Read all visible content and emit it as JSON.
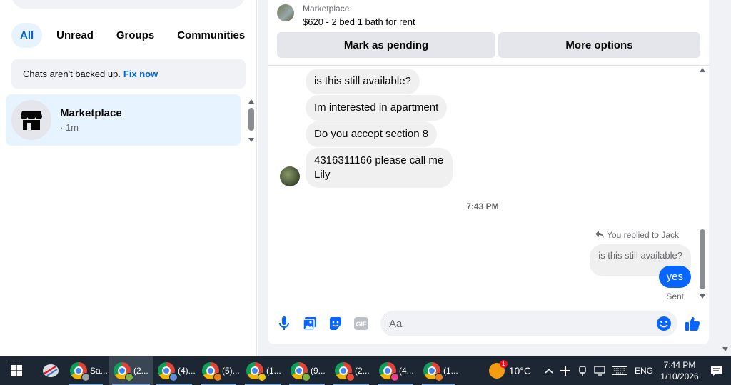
{
  "sidebar": {
    "filters": [
      "All",
      "Unread",
      "Groups",
      "Communities"
    ],
    "active_filter": "All",
    "notice": {
      "text": "Chats aren't backed up.",
      "link": "Fix now"
    },
    "chats": [
      {
        "name": "Marketplace",
        "time": "· 1m"
      }
    ]
  },
  "listing": {
    "source": "Marketplace",
    "title": "$620 - 2 bed 1 bath for rent"
  },
  "actions": {
    "pending_label": "Mark as pending",
    "more_label": "More options"
  },
  "messages": {
    "incoming": [
      "is this still available?",
      "Im interested in apartment",
      "Do you accept section 8",
      "4316311166 please call me Lily"
    ],
    "timestamp": "7:43 PM",
    "reply_context": "You replied to Jack",
    "quoted": "is this still available?",
    "outgoing": "yes",
    "status": "Sent"
  },
  "composer": {
    "placeholder": "Aa"
  },
  "taskbar": {
    "apps": [
      {
        "label": "Sa...",
        "badge": "c"
      },
      {
        "label": "(2...",
        "active": true
      },
      {
        "label": "(4)..."
      },
      {
        "label": "(5)..."
      },
      {
        "label": "(1..."
      },
      {
        "label": "(9..."
      },
      {
        "label": "(2..."
      },
      {
        "label": "(4..."
      },
      {
        "label": "(1..."
      }
    ],
    "weather_temp": "10°C",
    "weather_badge": "1",
    "language": "ENG",
    "time": "7:44 PM",
    "date": "1/10/2026"
  },
  "colors": {
    "accent": "#0866ff",
    "active_chip_bg": "#e7f3ff",
    "link": "#0064d1",
    "taskbar": "#1c2733"
  }
}
